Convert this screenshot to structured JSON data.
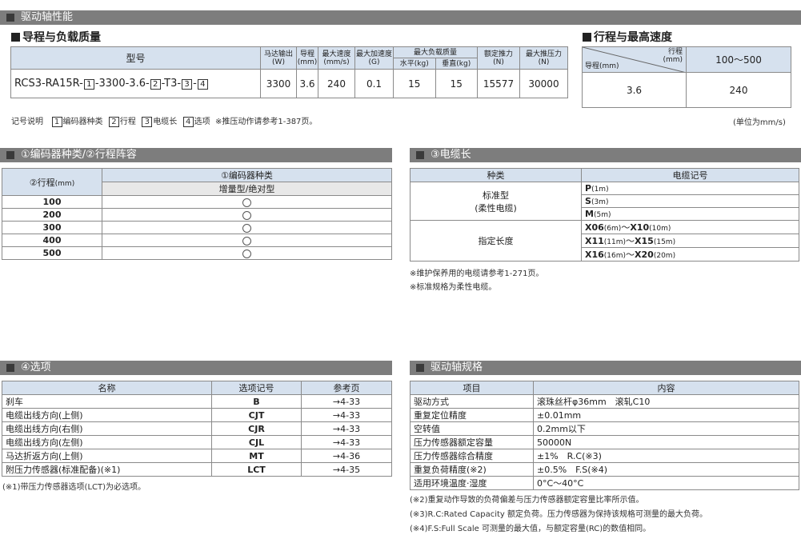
{
  "top_bar": "驱动轴性能",
  "lead_section": {
    "title": "导程与负载质量",
    "h_model": "型号",
    "h_motor": "马达输出",
    "h_motor_u": "(W)",
    "h_lead": "导程",
    "h_lead_u": "(mm)",
    "h_maxspeed": "最大速度",
    "h_maxspeed_u": "(mm/s)",
    "h_maxacc": "最大加速度",
    "h_maxacc_u": "(G)",
    "h_payload": "最大负载质量",
    "h_horiz": "水平",
    "h_horiz_u": "(kg)",
    "h_vert": "垂直",
    "h_vert_u": "(kg)",
    "h_rated": "额定推力",
    "h_rated_u": "(N)",
    "h_maxpush": "最大推压力",
    "h_maxpush_u": "(N)",
    "model_prefix": "RCS3-RA15R-",
    "model_box1": "1",
    "model_mid": "-3300-3.6-",
    "model_box2": "2",
    "model_t3": "-T3-",
    "model_box3": "3",
    "model_dash": "-",
    "model_box4": "4",
    "motor": "3300",
    "lead": "3.6",
    "maxspeed": "240",
    "maxacc": "0.1",
    "horiz": "15",
    "vert": "15",
    "rated": "15577",
    "maxpush": "30000"
  },
  "speed_section": {
    "title": "行程与最高速度",
    "diag_top": "行程",
    "diag_top_u": "(mm)",
    "diag_bottom": "导程",
    "diag_bottom_u": "(mm)",
    "stroke_range": "100〜500",
    "lead": "3.6",
    "speed": "240"
  },
  "legend": {
    "label": "记号说明",
    "b1": "1",
    "t1": "编码器种类",
    "b2": "2",
    "t2": "行程",
    "b3": "3",
    "t3": "电缆长",
    "b4": "4",
    "t4": "选项",
    "note": "※推压动作请参考1-387页。",
    "unit": "(单位为mm/s)"
  },
  "encoder_section": {
    "bar": "①编码器种类/②行程阵容",
    "h_stroke": "②行程",
    "h_stroke_u": "(mm)",
    "h_encoder": "①编码器种类",
    "h_type": "增量型/绝对型",
    "rows": [
      "100",
      "200",
      "300",
      "400",
      "500"
    ]
  },
  "cable_section": {
    "bar": "③电缆长",
    "h_kind": "种类",
    "h_code": "电缆记号",
    "standard": "标准型",
    "standard_sub": "(柔性电缆)",
    "specified": "指定长度",
    "codes": [
      {
        "a": "P",
        "a_u": "(1m)",
        "b": "",
        "b_u": ""
      },
      {
        "a": "S",
        "a_u": "(3m)",
        "b": "",
        "b_u": ""
      },
      {
        "a": "M",
        "a_u": "(5m)",
        "b": "",
        "b_u": ""
      },
      {
        "a": "X06",
        "a_u": "(6m)",
        "b": "X10",
        "b_u": "(10m)"
      },
      {
        "a": "X11",
        "a_u": "(11m)",
        "b": "X15",
        "b_u": "(15m)"
      },
      {
        "a": "X16",
        "a_u": "(16m)",
        "b": "X20",
        "b_u": "(20m)"
      }
    ],
    "tilde": "〜",
    "note1": "※维护保养用的电缆请参考1-271页。",
    "note2": "※标准规格为柔性电缆。"
  },
  "option_section": {
    "bar": "④选项",
    "h_name": "名称",
    "h_code": "选项记号",
    "h_page": "参考页",
    "rows": [
      {
        "name": "刹车",
        "code": "B",
        "page": "→4-33"
      },
      {
        "name": "电缆出线方向(上侧)",
        "code": "CJT",
        "page": "→4-33"
      },
      {
        "name": "电缆出线方向(右侧)",
        "code": "CJR",
        "page": "→4-33"
      },
      {
        "name": "电缆出线方向(左侧)",
        "code": "CJL",
        "page": "→4-33"
      },
      {
        "name": "马达折返方向(上侧)",
        "code": "MT",
        "page": "→4-36"
      },
      {
        "name": "附压力传感器(标准配备)(※1)",
        "code": "LCT",
        "page": "→4-35"
      }
    ],
    "note": "(※1)带压力传感器选项(LCT)为必选项。"
  },
  "spec_section": {
    "bar": "驱动轴规格",
    "h_item": "项目",
    "h_content": "内容",
    "rows": [
      {
        "item": "驱动方式",
        "content": "滚珠丝杆φ36mm　滚轧C10"
      },
      {
        "item": "重复定位精度",
        "content": "±0.01mm"
      },
      {
        "item": "空转值",
        "content": "0.2mm以下"
      },
      {
        "item": "压力传感器额定容量",
        "content": "50000N"
      },
      {
        "item": "压力传感器综合精度",
        "content": "±1%　R.C(※3)"
      },
      {
        "item": "重复负荷精度(※2)",
        "content": "±0.5%　F.S(※4)"
      },
      {
        "item": "适用环境温度·湿度",
        "content": "0°C〜40°C"
      }
    ],
    "note2": "(※2)重复动作导致的负荷偏差与压力传感器额定容量比率所示值。",
    "note3": "(※3)R.C:Rated Capacity 额定负荷。压力传感器为保持该规格可测量的最大负荷。",
    "note4": "(※4)F.S:Full Scale 可测量的最大值，与额定容量(RC)的数值相同。"
  }
}
